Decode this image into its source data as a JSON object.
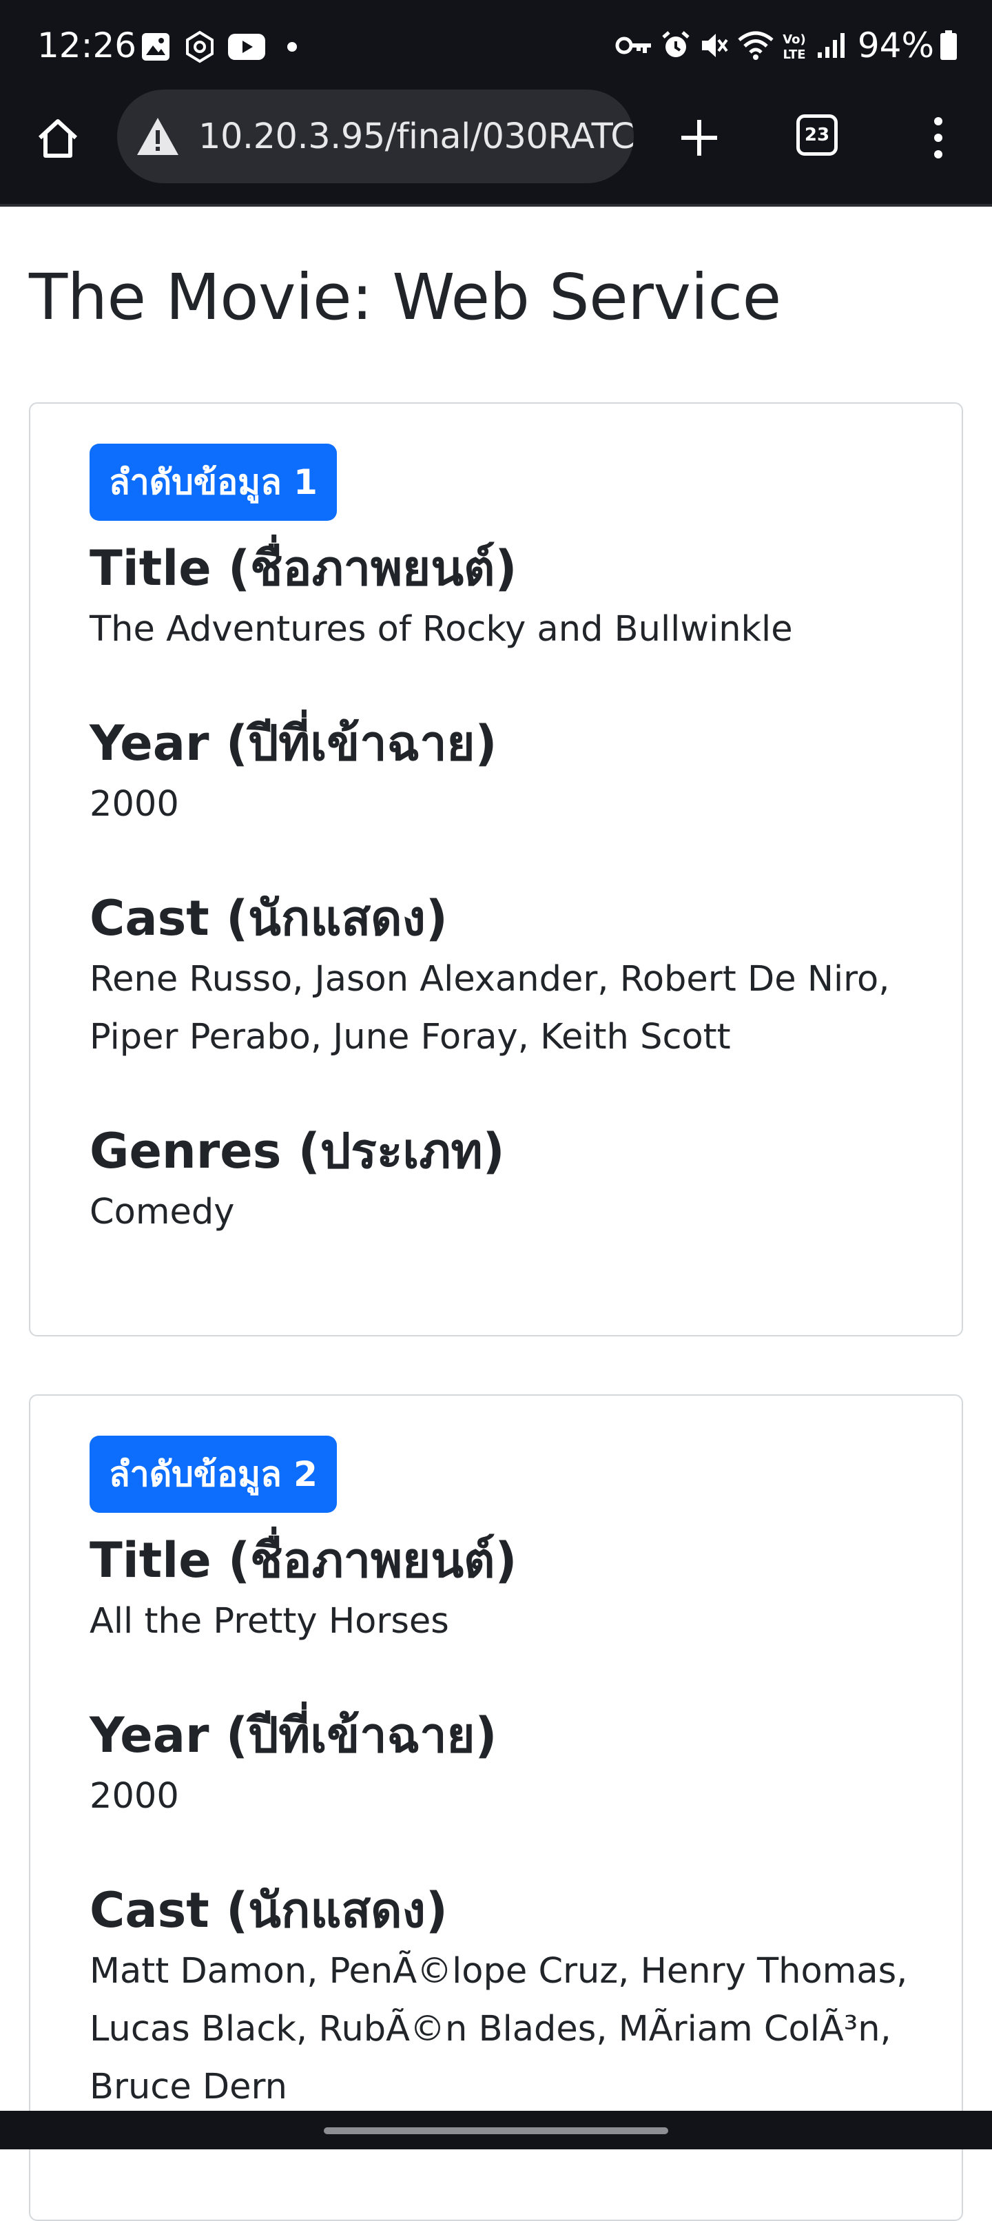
{
  "status_bar": {
    "time": "12:26",
    "battery": "94%",
    "left_icons": [
      "gallery-icon",
      "sync-icon",
      "youtube-icon",
      "dot-icon"
    ],
    "right_icons": [
      "vpn-key-icon",
      "alarm-icon",
      "mute-icon",
      "wifi-icon",
      "volte-icon",
      "signal-icon",
      "battery-icon"
    ]
  },
  "browser": {
    "url": "10.20.3.95/final/030RATC",
    "tab_count": "23"
  },
  "page": {
    "title": "The Movie: Web Service"
  },
  "records": [
    {
      "badge": "ลำดับข้อมูล 1",
      "title_label": "Title (ชื่อภาพยนต์)",
      "title": "The Adventures of Rocky and Bullwinkle",
      "year_label": "Year (ปีที่เข้าฉาย)",
      "year": "2000",
      "cast_label": "Cast (นักแสดง)",
      "cast": "Rene Russo, Jason Alexander, Robert De Niro, Piper Perabo, June Foray, Keith Scott",
      "genres_label": "Genres (ประเภท)",
      "genres": "Comedy"
    },
    {
      "badge": "ลำดับข้อมูล 2",
      "title_label": "Title (ชื่อภาพยนต์)",
      "title": "All the Pretty Horses",
      "year_label": "Year (ปีที่เข้าฉาย)",
      "year": "2000",
      "cast_label": "Cast (นักแสดง)",
      "cast": "Matt Damon, PenÃ©lope Cruz, Henry Thomas, Lucas Black, RubÃ©n Blades, MÃ­riam ColÃ³n, Bruce Dern"
    }
  ],
  "colors": {
    "badge": "#0d6efd",
    "chrome_bg": "#121318",
    "omnibox_bg": "#2b2c31",
    "text": "#212529",
    "card_border": "#d5d8db"
  }
}
